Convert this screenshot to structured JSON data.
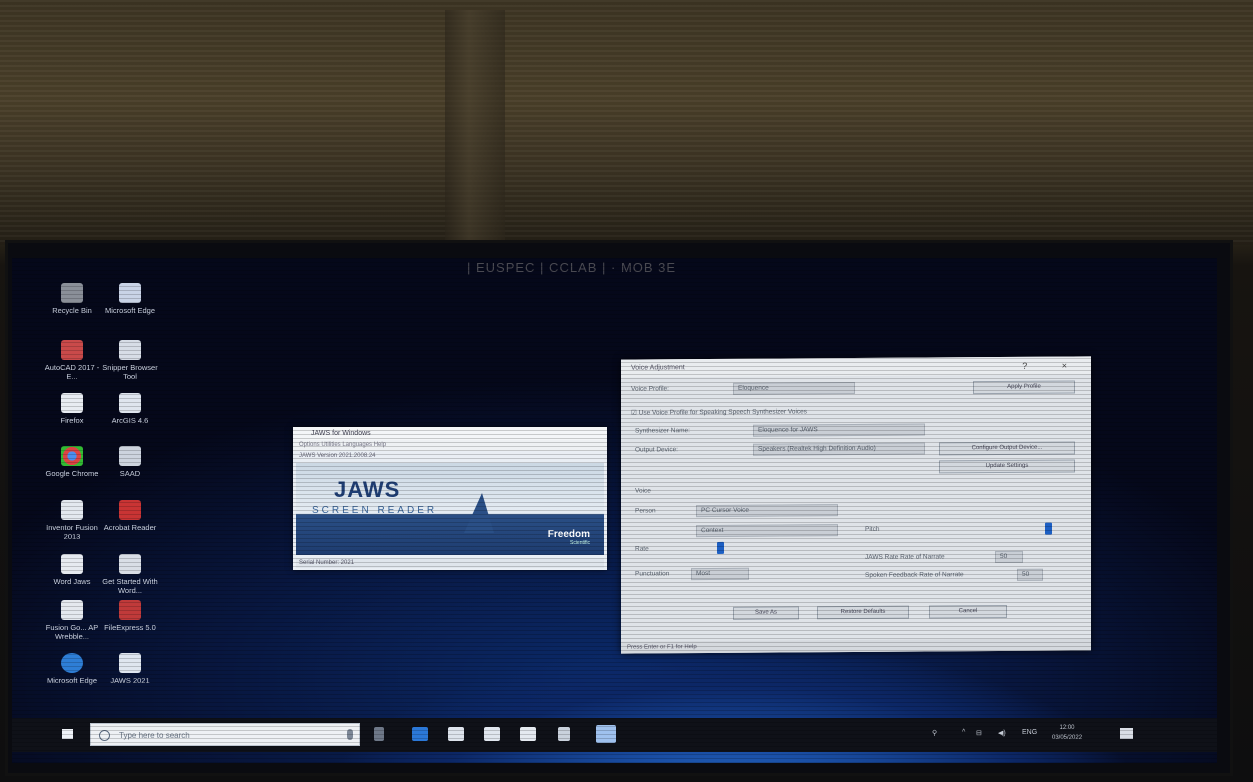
{
  "desktop": {
    "label_top": "| EUSPEC | CCLAB | · MOB 3E",
    "icons": [
      {
        "label": "Recycle Bin",
        "icon": "recycle-bin-icon"
      },
      {
        "label": "Microsoft Edge",
        "icon": "edge-icon"
      },
      {
        "label": "AutoCAD 2017 - E...",
        "icon": "autocad-icon"
      },
      {
        "label": "Snipper Browser Tool",
        "icon": "app-icon"
      },
      {
        "label": "Firefox",
        "icon": "firefox-icon"
      },
      {
        "label": "ArcGIS 4.6",
        "icon": "arcgis-icon"
      },
      {
        "label": "Google Chrome",
        "icon": "chrome-icon"
      },
      {
        "label": "SAAD",
        "icon": "app-icon"
      },
      {
        "label": "Inventor Fusion 2013",
        "icon": "inventor-icon"
      },
      {
        "label": "Acrobat Reader",
        "icon": "acrobat-icon"
      },
      {
        "label": "Word Jaws",
        "icon": "app-icon"
      },
      {
        "label": "Get Started With Word...",
        "icon": "app-icon"
      },
      {
        "label": "Fusion Go... AP Wrebble...",
        "icon": "app-icon"
      },
      {
        "label": "FileExpress 5.0",
        "icon": "app-icon"
      },
      {
        "label": "Microsoft Edge",
        "icon": "edge-icon"
      },
      {
        "label": "JAWS 2021",
        "icon": "jaws-icon"
      }
    ]
  },
  "jaws_splash": {
    "title": "JAWS for Windows",
    "menu": "Options   Utilities   Languages   Help",
    "info": "JAWS Version 2021.2008.24",
    "logo": "JAWS",
    "sub": "SCREEN READER",
    "brand": "Freedom",
    "brand_sub": "Scientific",
    "status": "Serial Number: 2021"
  },
  "settings_dialog": {
    "title": "Voice Adjustment",
    "window_controls": "? ×",
    "profile_label": "Voice Profile:",
    "profile_value": "Eloquence",
    "apply_button": "Apply Profile",
    "checkbox_label": "Use Voice Profile for Speaking Speech Synthesizer Voices",
    "synth_label": "Synthesizer Name:",
    "synth_value": "Eloquence for JAWS",
    "output_label": "Output Device:",
    "output_value": "Speakers (Realtek High Definition Audio)",
    "device_button": "Configure Output Device...",
    "update_button": "Update Settings",
    "voice_header": "Voice",
    "person_label": "Person",
    "person_value": "PC Cursor Voice",
    "context_value": "Context",
    "rate_label": "Rate",
    "rate_value_label": "Pitch",
    "speak_rate_label": "JAWS Rate Rate of Narrate",
    "speak_rate_value": "50",
    "volume_label": "Punctuation",
    "volume_value": "Most",
    "spoken_label": "Spoken Feedback Rate of Narrate",
    "spoken_value": "50",
    "ok_button": "Save As",
    "mid_button": "Restore Defaults",
    "cancel_button": "Cancel",
    "status": "Press Enter or F1 for Help"
  },
  "taskbar": {
    "search_placeholder": "Type here to search",
    "lang": "ENG",
    "time": "12:00",
    "date": "03/05/2022"
  }
}
